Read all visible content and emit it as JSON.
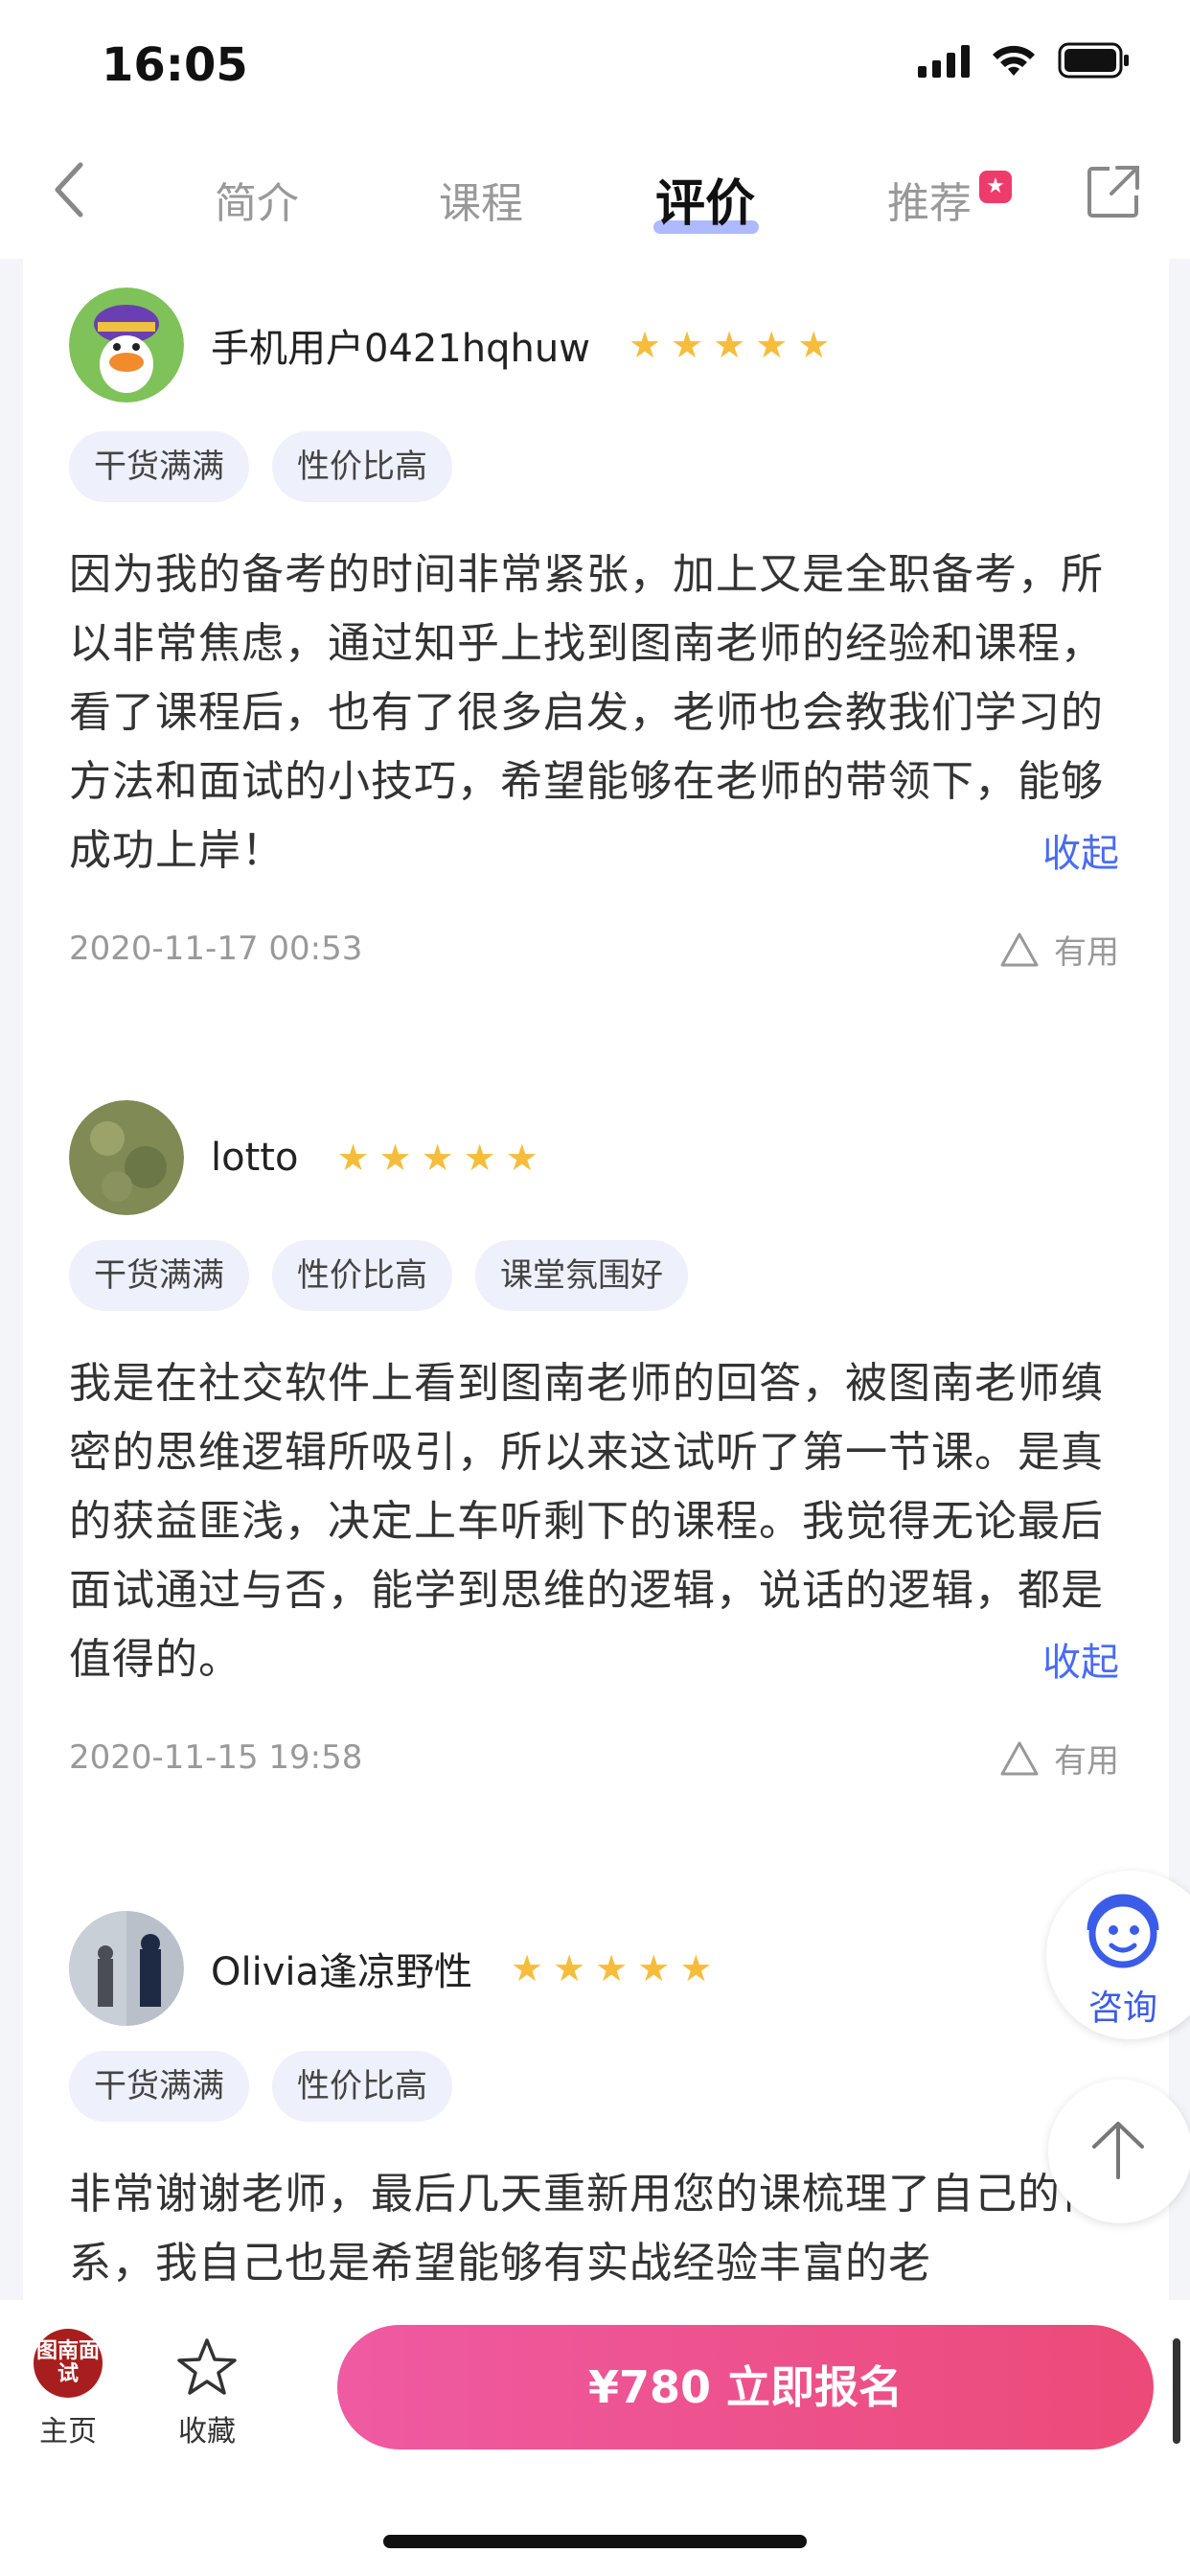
{
  "status_bar": {
    "time": "16:05"
  },
  "nav": {
    "tabs": [
      {
        "label": "简介",
        "active": false
      },
      {
        "label": "课程",
        "active": false
      },
      {
        "label": "评价",
        "active": true
      },
      {
        "label": "推荐",
        "active": false
      }
    ]
  },
  "colors": {
    "accent": "#4a6cf0",
    "star": "#f5bd3b",
    "cta_start": "#ef5aa2",
    "cta_end": "#ec4a78"
  },
  "reviews": [
    {
      "user": "手机用户0421hqhuw",
      "stars": 5,
      "tags": [
        "干货满满",
        "性价比高"
      ],
      "content": "因为我的备考的时间非常紧张，加上又是全职备考，所以非常焦虑，通过知乎上找到图南老师的经验和课程，看了课程后，也有了很多启发，老师也会教我们学习的方法和面试的小技巧，希望能够在老师的带领下，能够成功上岸！",
      "collapse": "收起",
      "date": "2020-11-17 00:53",
      "useful": "有用"
    },
    {
      "user": "lotto",
      "stars": 5,
      "tags": [
        "干货满满",
        "性价比高",
        "课堂氛围好"
      ],
      "content": "我是在社交软件上看到图南老师的回答，被图南老师缜密的思维逻辑所吸引，所以来这试听了第一节课。是真的获益匪浅，决定上车听剩下的课程。我觉得无论最后面试通过与否，能学到思维的逻辑，说话的逻辑，都是值得的。",
      "collapse": "收起",
      "date": "2020-11-15 19:58",
      "useful": "有用"
    },
    {
      "user": "Olivia逢凉野性",
      "stars": 5,
      "tags": [
        "干货满满",
        "性价比高"
      ],
      "content": "非常谢谢老师，最后几天重新用您的课梳理了自己的体系，我自己也是希望能够有实战经验丰富的老"
    }
  ],
  "floating": {
    "consult_label": "咨询"
  },
  "bottom_bar": {
    "home_logo": "图南面试",
    "home_label": "主页",
    "fav_label": "收藏",
    "cta_label": "¥780  立即报名"
  }
}
